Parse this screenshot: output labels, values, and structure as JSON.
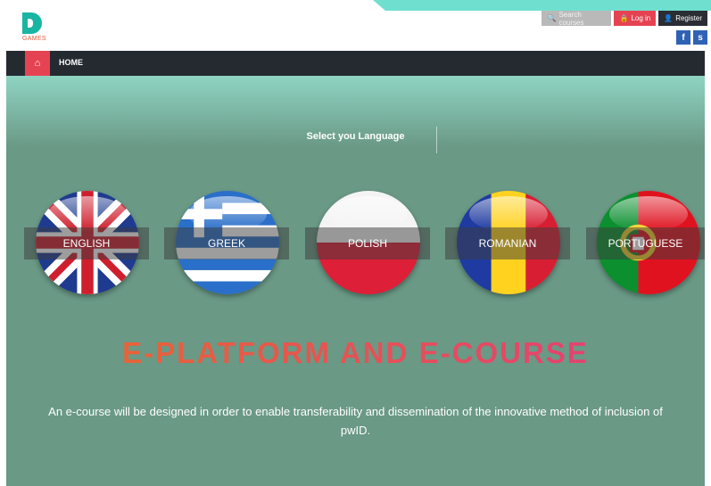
{
  "brand": {
    "logo_text": "GAMES"
  },
  "header": {
    "search_label": "Search courses",
    "login_label": "Log in",
    "register_label": "Register",
    "social": [
      {
        "icon": "facebook-icon",
        "glyph": "f"
      },
      {
        "icon": "skype-icon",
        "glyph": "s"
      }
    ]
  },
  "nav": {
    "home_label": "HOME"
  },
  "hero": {
    "select_language": "Select you Language",
    "languages": [
      {
        "label": "ENGLISH",
        "flag": "uk-flag"
      },
      {
        "label": "GREEK",
        "flag": "greece-flag"
      },
      {
        "label": "POLISH",
        "flag": "poland-flag"
      },
      {
        "label": "ROMANIAN",
        "flag": "romania-flag"
      },
      {
        "label": "PORTUGUESE",
        "flag": "portugal-flag"
      }
    ],
    "headline": "E-PLATFORM AND E-COURSE",
    "description": "An e-course will be designed in order to enable transferability and dissemination of the innovative method of inclusion of pwID."
  },
  "colors": {
    "accent_red": "#e64352",
    "nav_dark": "#252a30",
    "hero_green": "#6a9986",
    "teal": "#6fe0cf",
    "headline_gradient_start": "#ea6a2a",
    "headline_gradient_end": "#e33a7e"
  }
}
